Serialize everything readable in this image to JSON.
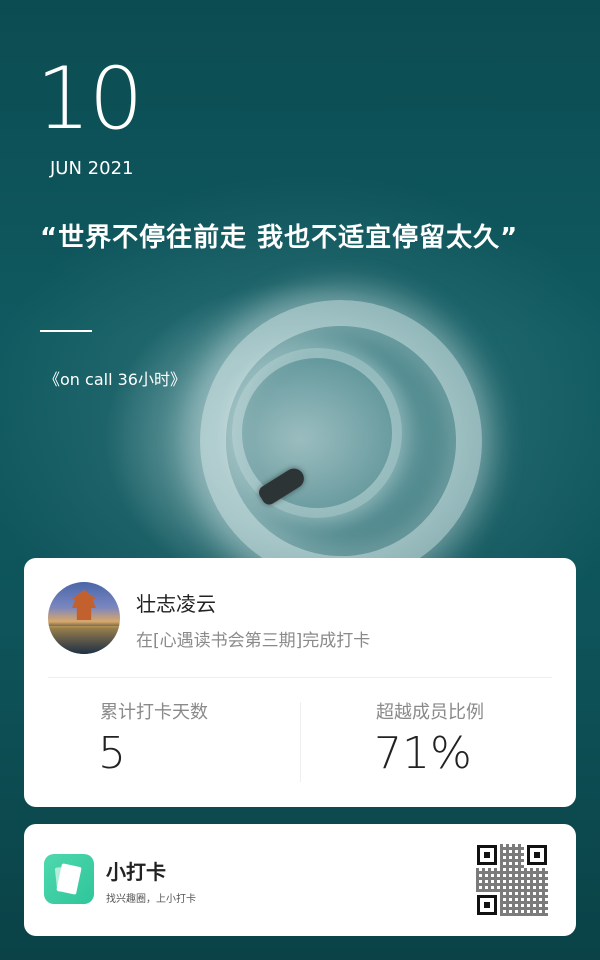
{
  "header": {
    "day": "10",
    "month_year": "JUN 2021"
  },
  "quote": {
    "text": "“世界不停往前走 我也不适宜停留太久”",
    "source": "《on call 36小时》"
  },
  "profile": {
    "name": "壮志凌云",
    "subtitle": "在[心遇读书会第三期]完成打卡",
    "stats": [
      {
        "label": "累计打卡天数",
        "value": "5"
      },
      {
        "label": "超越成员比例",
        "value": "71%"
      }
    ]
  },
  "brand": {
    "name": "小打卡",
    "slogan": "找兴趣圈，上小打卡",
    "logo_color": "#34c9a0"
  }
}
